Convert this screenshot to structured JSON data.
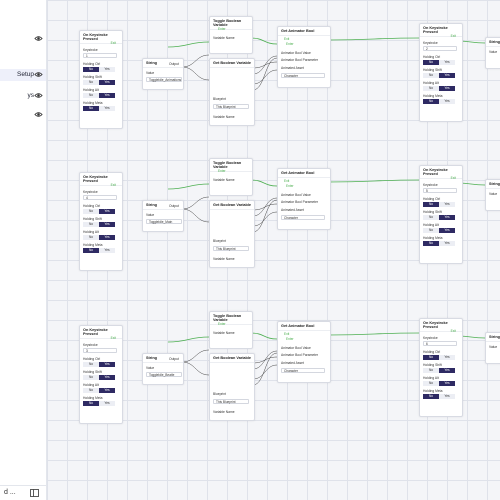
{
  "sidebar": {
    "items": [
      {
        "label": "",
        "selected": false,
        "icon": "eye-icon"
      },
      {
        "label": "Setup",
        "selected": true,
        "icon": "eye-icon"
      },
      {
        "label": "ys",
        "selected": false,
        "icon": "eye-icon"
      },
      {
        "label": "",
        "selected": false,
        "icon": "eye-icon"
      }
    ],
    "footer": {
      "label": "d ...",
      "icon": "panel-toggle-icon"
    }
  },
  "common": {
    "on_keystroke": "On Keystroke Pressed",
    "keystroke": "Keystroke",
    "holding_ctrl": "Holding Ctrl",
    "holding_shift": "Holding Shift",
    "holding_alt": "Holding Alt",
    "holding_meta": "Holding Meta",
    "no": "No",
    "yes": "Yes",
    "exit": "Exit",
    "enter": "Enter",
    "string": "String",
    "value": "Value",
    "output": "Output",
    "toggle_bool": "Toggle Boolean Variable",
    "variable_name": "Variable Name",
    "get_bool": "Get Boolean Variable",
    "blueprint": "Blueprint",
    "this_blueprint": "This Blueprint",
    "get_anim_bool": "Get Animator Bool",
    "anim_bool_value": "Animator Bool Value",
    "anim_bool_param": "Animator Bool Parameter",
    "anim_asset": "Animated Asset",
    "character": "Character"
  },
  "rows": [
    {
      "key": "1",
      "string_value": "ToggleIdle_Animations",
      "ctrl": "no"
    },
    {
      "key": "4",
      "string_value": "ToggleIdle_Main",
      "ctrl": "yes"
    },
    {
      "key": "3",
      "string_value": "ToggleIdle_Beatle",
      "ctrl": "yes"
    }
  ],
  "right_col": [
    {
      "key": "2"
    },
    {
      "key": "5"
    },
    {
      "key": "6"
    }
  ],
  "colors": {
    "exec": "#4caf50",
    "toggle_on": "#2e2a63",
    "grid": "#dfe2ea",
    "canvas": "#f4f5f8"
  }
}
